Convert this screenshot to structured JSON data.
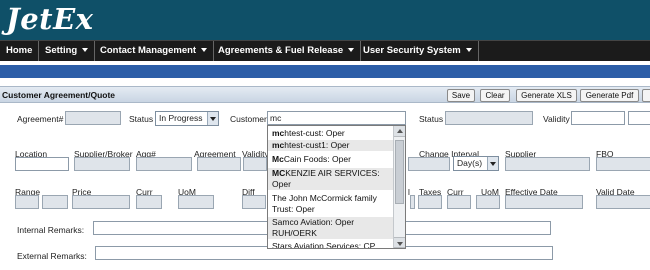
{
  "app": {
    "logo": "JetEx"
  },
  "nav": {
    "home": "Home",
    "setting": "Setting",
    "contact_management": "Contact Management",
    "agreements_fuel_release": "Agreements & Fuel Release",
    "user_security_system": "User Security System"
  },
  "section": {
    "title": "Customer Agreement/Quote",
    "buttons": {
      "save": "Save",
      "clear": "Clear",
      "generate_xls": "Generate XLS",
      "generate_pdf": "Generate Pdf"
    }
  },
  "form": {
    "agreement_label": "Agreement#",
    "status_label": "Status",
    "status_value": "In Progress",
    "customer_label": "Customer",
    "customer_value": "mc",
    "status2_label": "Status",
    "validity_label": "Validity",
    "location_label": "Location",
    "supplier_broker_label": "Supplier/Broker",
    "agg_label": "Agg#",
    "agreement_col_label": "Agreement",
    "validity_col_label": "Validity",
    "change_interval_label": "Change Interval",
    "change_interval_value": "Day(s)",
    "supplier_label": "Supplier",
    "fbo_label": "FBO",
    "range_label": "Range",
    "price_label": "Price",
    "curr_label": "Curr",
    "uom_label": "UoM",
    "diff_label": "Diff",
    "cut_label": "l",
    "taxes_label": "Taxes",
    "curr2_label": "Curr",
    "uom2_label": "UoM",
    "effective_date_label": "Effective Date",
    "valid_date_label": "Valid Date",
    "internal_remarks_label": "Internal Remarks:",
    "external_remarks_label": "External Remarks:"
  },
  "dropdown": {
    "items": [
      {
        "bold": "mc",
        "rest": "htest-cust: Oper"
      },
      {
        "bold": "mc",
        "rest": "htest-cust1: Oper"
      },
      {
        "bold": "Mc",
        "rest": "Cain Foods: Oper"
      },
      {
        "bold": "MC",
        "rest": "KENZIE AIR SERVICES:"
      },
      {
        "bold": "",
        "rest": "Oper"
      },
      {
        "bold": "",
        "rest": "The John McCormick family"
      },
      {
        "bold": "",
        "rest": "Trust: Oper"
      },
      {
        "bold": "",
        "rest": "Samco Aviation: Oper"
      },
      {
        "bold": "",
        "rest": "RUH/OERK"
      },
      {
        "bold": "",
        "rest": "Stars Aviation Services: CP"
      }
    ]
  }
}
